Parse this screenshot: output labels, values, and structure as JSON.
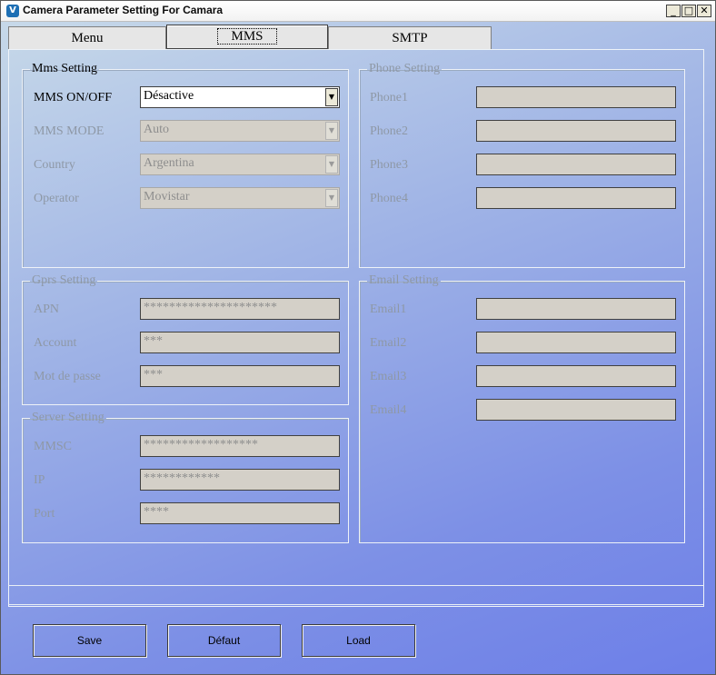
{
  "window": {
    "title": "Camera Parameter Setting For  Camara",
    "min_symbol": "_",
    "max_symbol": "□",
    "close_symbol": "✕"
  },
  "tabs": [
    {
      "label": "Menu",
      "active": false
    },
    {
      "label": "MMS",
      "active": true
    },
    {
      "label": "SMTP",
      "active": false
    }
  ],
  "mms_setting": {
    "legend": "Mms Setting",
    "rows": [
      {
        "label": "MMS ON/OFF",
        "value": "Désactive",
        "enabled": true
      },
      {
        "label": "MMS MODE",
        "value": "Auto",
        "enabled": false
      },
      {
        "label": "Country",
        "value": "Argentina",
        "enabled": false
      },
      {
        "label": "Operator",
        "value": "Movistar",
        "enabled": false
      }
    ]
  },
  "phone_setting": {
    "legend": "Phone Setting",
    "rows": [
      {
        "label": "Phone1",
        "value": ""
      },
      {
        "label": "Phone2",
        "value": ""
      },
      {
        "label": "Phone3",
        "value": ""
      },
      {
        "label": "Phone4",
        "value": ""
      }
    ]
  },
  "gprs_setting": {
    "legend": "Gprs Setting",
    "rows": [
      {
        "label": "APN",
        "value": "*********************"
      },
      {
        "label": "Account",
        "value": "***"
      },
      {
        "label": "Mot de passe",
        "value": "***"
      }
    ]
  },
  "email_setting": {
    "legend": "Email Setting",
    "rows": [
      {
        "label": "Email1",
        "value": ""
      },
      {
        "label": "Email2",
        "value": ""
      },
      {
        "label": "Email3",
        "value": ""
      },
      {
        "label": "Email4",
        "value": ""
      }
    ]
  },
  "server_setting": {
    "legend": "Server Setting",
    "rows": [
      {
        "label": "MMSC",
        "value": "******************"
      },
      {
        "label": "IP",
        "value": "************"
      },
      {
        "label": "Port",
        "value": "****"
      }
    ]
  },
  "buttons": {
    "save": "Save",
    "default": "Défaut",
    "load": "Load"
  },
  "colors": {
    "disabled_text": "#8e98a6",
    "field_bg": "#d4d0c8",
    "bg_gradient_start": "#c9dbe9",
    "bg_gradient_end": "#6d7fe8"
  },
  "icons": {
    "app": "camera-app-icon",
    "dropdown": "dropdown-arrow-icon"
  }
}
